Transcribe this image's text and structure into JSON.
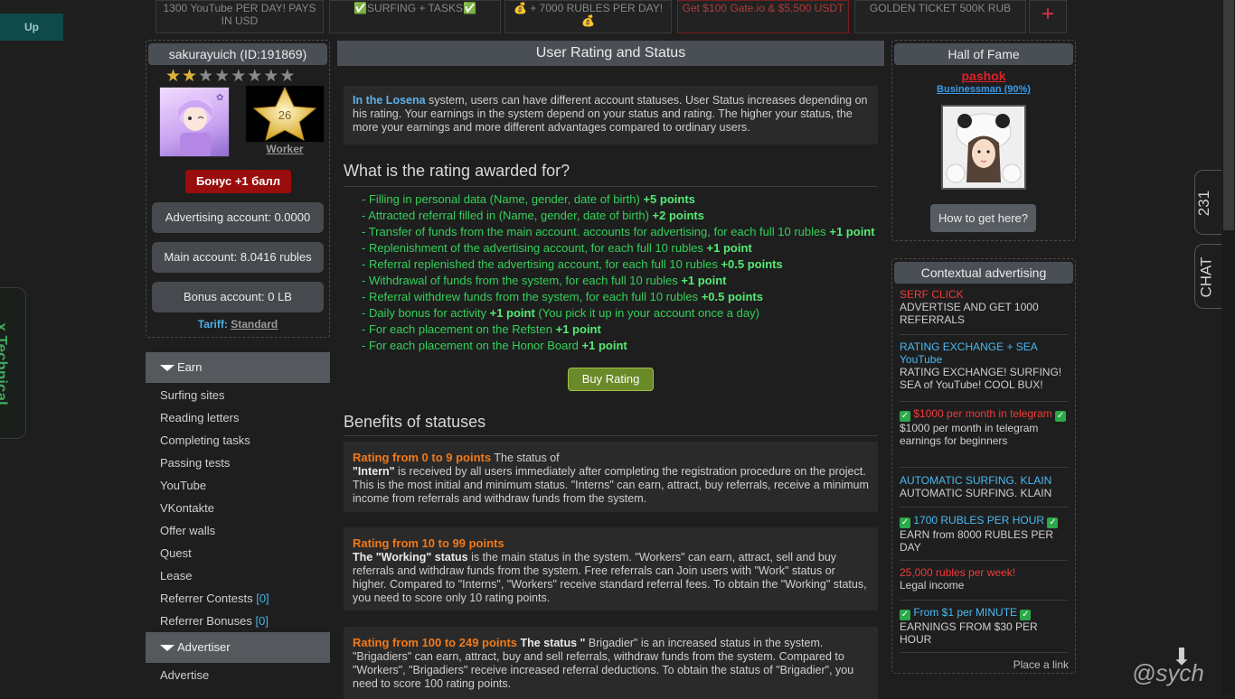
{
  "up_button": "Up",
  "banners": [
    {
      "text": "1300 YouTube PER DAY! PAYS IN USD",
      "color": "#8a8a8a"
    },
    {
      "text": "✅SURFING + TASKS✅",
      "color": "#8a8a8a"
    },
    {
      "text": "💰 + 7000 RUBLES PER DAY! 💰",
      "color": "#8a8a8a"
    },
    {
      "text": "Get $100 Gate.io & $5,500 USDT",
      "color": "#b03a3a"
    },
    {
      "text": "GOLDEN TICKET 500K RUB",
      "color": "#8a8a8a"
    }
  ],
  "add_banner": "+",
  "profile": {
    "username": "sakurayuich (ID:191869)",
    "stars_filled": 2,
    "stars_total": 8,
    "level_number": "26",
    "status_label": "Worker",
    "bonus_button": "Бонус +1 балл",
    "advertising_account": "Advertising account: 0.0000",
    "main_account": "Main account: 8.0416 rubles",
    "bonus_account": "Bonus account: 0 LB",
    "tariff_label": "Tariff:",
    "tariff_value": "Standard"
  },
  "menu": {
    "earn_head": "Earn",
    "earn_items": [
      "Surfing sites",
      "Reading letters",
      "Completing tasks",
      "Passing tests",
      "YouTube",
      "VKontakte",
      "Offer walls",
      "Quest",
      "Lease",
      "Referrer Contests",
      "Referrer Bonuses"
    ],
    "referrer_contests_count": "[0]",
    "referrer_bonuses_count": "[0]",
    "advertiser_head": "Advertiser",
    "advertiser_items": [
      "Advertise"
    ]
  },
  "center": {
    "title": "User Rating and Status",
    "intro_highlight": "In the Losena",
    "intro_rest": " system, users can have different account statuses. User Status increases depending on his rating. Your earnings in the system depend on your status and rating. The higher your status, the more your earnings and more different advantages compared to ordinary users.",
    "rating_title": "What is the rating awarded for?",
    "rating_items": [
      {
        "text": "- Filling in personal data (Name, gender, date of birth) ",
        "pts": "+5 points",
        "tail": ""
      },
      {
        "text": "- Attracted referral filled in (Name, gender, date of birth) ",
        "pts": "+2 points",
        "tail": ""
      },
      {
        "text": "- Transfer of funds from the main account. accounts for advertising, for each full 10 rubles ",
        "pts": "+1 point",
        "tail": ""
      },
      {
        "text": "- Replenishment of the advertising account, for each full 10 rubles ",
        "pts": "+1 point",
        "tail": ""
      },
      {
        "text": "- Referral replenished the advertising account, for each full 10 rubles ",
        "pts": "+0.5 points",
        "tail": ""
      },
      {
        "text": "- Withdrawal of funds from the system, for each full 10 rubles ",
        "pts": "+1 point",
        "tail": ""
      },
      {
        "text": "- Referral withdrew funds from the system, for each full 10 rubles ",
        "pts": "+0.5 points",
        "tail": ""
      },
      {
        "text": "- Daily bonus for activity ",
        "pts": "+1 point",
        "tail": " (You pick it up in your account once a day)"
      },
      {
        "text": "- For each placement on the Refsten ",
        "pts": "+1 point",
        "tail": ""
      },
      {
        "text": "- For each placement on the Honor Board ",
        "pts": "+1 point",
        "tail": ""
      }
    ],
    "buy_button": "Buy Rating",
    "benefits_title": "Benefits of statuses",
    "benefits": [
      {
        "range": "Rating from 0 to 9 points",
        "after_range": " The status of",
        "status": "\"Intern\"",
        "body": " is received by all users immediately after completing the registration procedure on the project. This is the most initial and minimum status. \"Interns\" can earn, attract, buy referrals, receive a minimum income from referrals and withdraw funds from the system."
      },
      {
        "range": "Rating from 10 to 99 points",
        "after_range": "",
        "status": "The \"Working\" status",
        "body": " is the main status in the system. \"Workers\" can earn, attract, sell and buy referrals and withdraw funds from the system. Free referrals can Join users with \"Work\" status or higher. Compared to \"Interns\", \"Workers\" receive standard referral fees. To obtain the \"Working\" status, you need to score only 10 rating points."
      },
      {
        "range": "Rating from 100 to 249 points",
        "after_range": "",
        "status": " The status \"",
        "body": " Brigadier\" is an increased status in the system. \"Brigadiers\" can earn, attract, buy and sell referrals, withdraw funds from the system. Compared to \"Workers\", \"Brigadiers\" receive increased referral deductions. To obtain the status of \"Brigadier\", you need to score 100 rating points."
      }
    ]
  },
  "hall_of_fame": {
    "title": "Hall of Fame",
    "name": "pashok",
    "status": "Businessman (90%)",
    "howto_button": "How to get here?"
  },
  "context_ads": {
    "title": "Contextual advertising",
    "items": [
      {
        "title": "SERF CLICK",
        "desc": "ADVERTISE AND GET 1000 REFERRALS",
        "color": "#f03a3a"
      },
      {
        "title": "RATING EXCHANGE + SEA YouTube",
        "desc": "RATING EXCHANGE! SURFING! SEA of YouTube! COOL BUX!",
        "color": "#4ab8f0"
      },
      {
        "title": "$1000 per month in telegram",
        "desc": "$1000 per month in telegram earnings for beginners",
        "color": "#f03a3a"
      },
      {
        "title": "AUTOMATIC SURFING. KLAIN",
        "desc": "AUTOMATIC SURFING. KLAIN",
        "color": "#4ab8f0"
      },
      {
        "title": "1700 RUBLES PER HOUR",
        "desc": "EARN from 8000 RUBLES PER DAY",
        "color": "#4ab8f0"
      },
      {
        "title": "25,000 rubles per week!",
        "desc": "Legal income",
        "color": "#f03a3a"
      },
      {
        "title": "From $1 per MINUTE",
        "desc": "EARNINGS FROM $30 PER HOUR",
        "color": "#4ab8f0"
      }
    ],
    "place_link": "Place a link"
  },
  "side": {
    "counter": "231",
    "chat": "CHAT",
    "technical": "x Technical",
    "watermark": "@sych"
  }
}
